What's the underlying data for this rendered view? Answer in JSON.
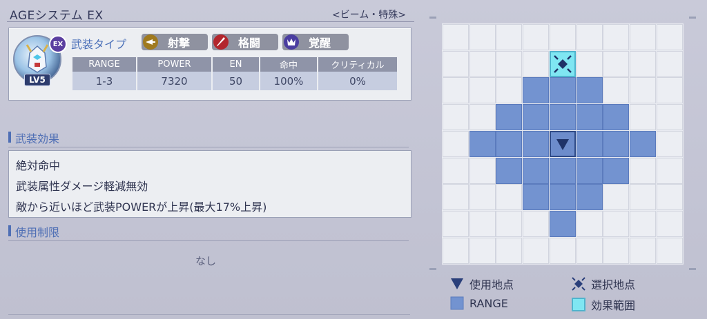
{
  "header": {
    "weapon_name": "AGEシステム EX",
    "weapon_category": "<ビーム・特殊>"
  },
  "card": {
    "badge_ex": "EX",
    "badge_lv": "LV5",
    "weapon_type_label": "武装タイプ",
    "attributes": [
      {
        "label": "射撃",
        "icon": "shooting-icon",
        "color": "#a07a1f"
      },
      {
        "label": "格闘",
        "icon": "melee-icon",
        "color": "#b3262d"
      },
      {
        "label": "覚醒",
        "icon": "awaken-icon",
        "color": "#4a3da0"
      }
    ],
    "stats": {
      "headers": [
        "RANGE",
        "POWER",
        "EN",
        "命中",
        "クリティカル"
      ],
      "values": [
        "1-3",
        "7320",
        "50",
        "100%",
        "0%"
      ]
    }
  },
  "effects_section": {
    "title": "武装効果",
    "lines": [
      "絶対命中",
      "武装属性ダメージ軽減無効",
      "敵から近いほど武装POWERが上昇(最大17%上昇)"
    ]
  },
  "restriction_section": {
    "title": "使用制限",
    "value": "なし"
  },
  "range_grid": {
    "cols": 9,
    "rows": 9,
    "range_cells": [
      [
        3,
        2
      ],
      [
        4,
        2
      ],
      [
        5,
        2
      ],
      [
        2,
        3
      ],
      [
        3,
        3
      ],
      [
        4,
        3
      ],
      [
        5,
        3
      ],
      [
        6,
        3
      ],
      [
        1,
        4
      ],
      [
        2,
        4
      ],
      [
        3,
        4
      ],
      [
        5,
        4
      ],
      [
        6,
        4
      ],
      [
        7,
        4
      ],
      [
        2,
        5
      ],
      [
        3,
        5
      ],
      [
        4,
        5
      ],
      [
        5,
        5
      ],
      [
        6,
        5
      ],
      [
        3,
        6
      ],
      [
        4,
        6
      ],
      [
        5,
        6
      ],
      [
        4,
        7
      ]
    ],
    "effect_cell": [
      4,
      1
    ],
    "origin_cell": [
      4,
      4
    ]
  },
  "legend": {
    "use_point": "使用地点",
    "select_point": "選択地点",
    "range": "RANGE",
    "effect_area": "効果範囲"
  },
  "colors": {
    "accent": "#4f6fb5",
    "range": "#7393d0",
    "effect": "#7fe6f2"
  }
}
